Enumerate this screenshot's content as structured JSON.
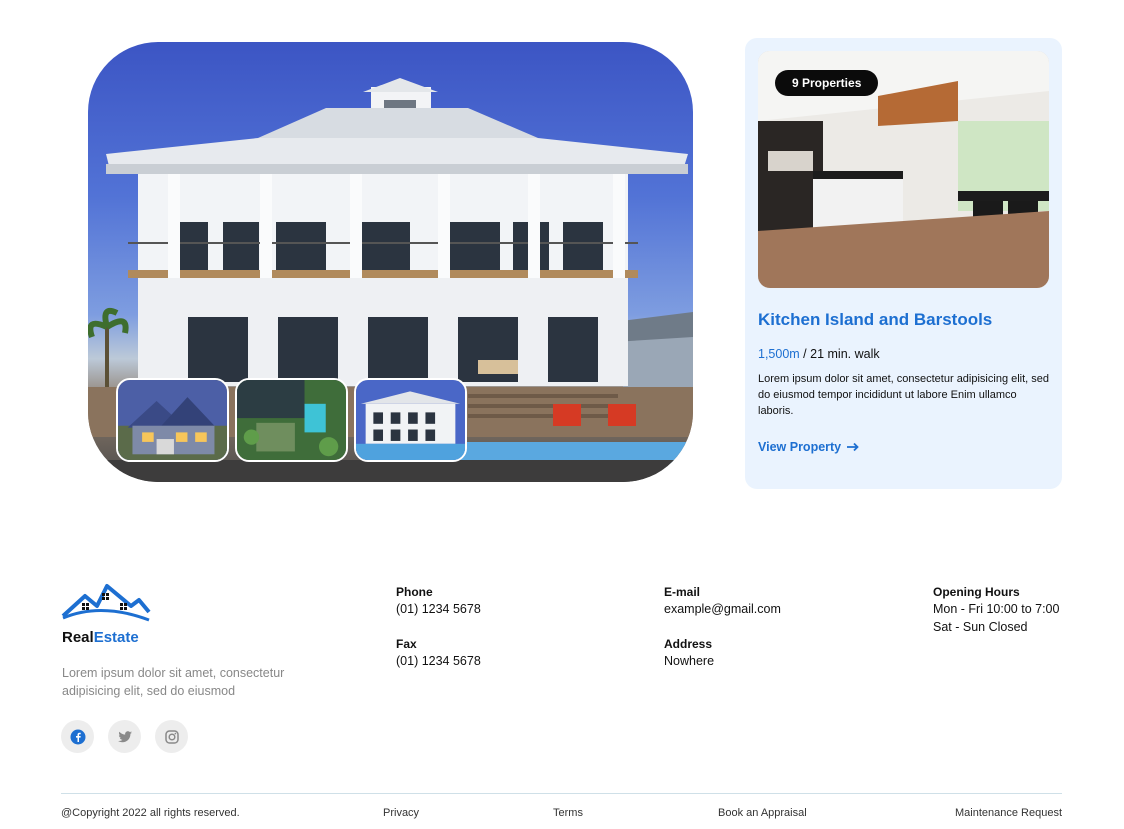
{
  "hero": {
    "thumbnails": [
      "house-dusk",
      "pool-aerial",
      "beach-house"
    ]
  },
  "card": {
    "badge": "9 Properties",
    "title": "Kitchen Island and Barstools",
    "distance": "1,500m",
    "walk": " / 21 min. walk",
    "description": "Lorem ipsum dolor sit amet, consectetur adipisicing elit, sed do eiusmod tempor incididunt ut labore Enim ullamco laboris.",
    "link_label": "View Property",
    "link_icon": "arrow-right-icon"
  },
  "footer": {
    "brand_part1": "Real",
    "brand_part2": "Estate",
    "tagline": "Lorem ipsum dolor sit amet, consectetur adipisicing elit, sed do eiusmod",
    "socials": [
      "facebook-icon",
      "twitter-icon",
      "instagram-icon"
    ],
    "phone_label": "Phone",
    "phone_value": "(01) 1234 5678",
    "fax_label": "Fax",
    "fax_value": "(01) 1234 5678",
    "email_label": "E-mail",
    "email_value": "example@gmail.com",
    "address_label": "Address",
    "address_value": "Nowhere",
    "hours_label": "Opening Hours",
    "hours_line1": "Mon - Fri 10:00 to 7:00",
    "hours_line2": "Sat - Sun Closed"
  },
  "bottom": {
    "copyright": "@Copyright 2022 all rights reserved.",
    "privacy": "Privacy",
    "terms": "Terms",
    "appraisal": "Book an Appraisal",
    "maintenance": "Maintenance Request"
  },
  "colors": {
    "accent": "#1d6fd1",
    "card_bg": "#eaf3fe",
    "badge_bg": "#0b0b0b"
  }
}
